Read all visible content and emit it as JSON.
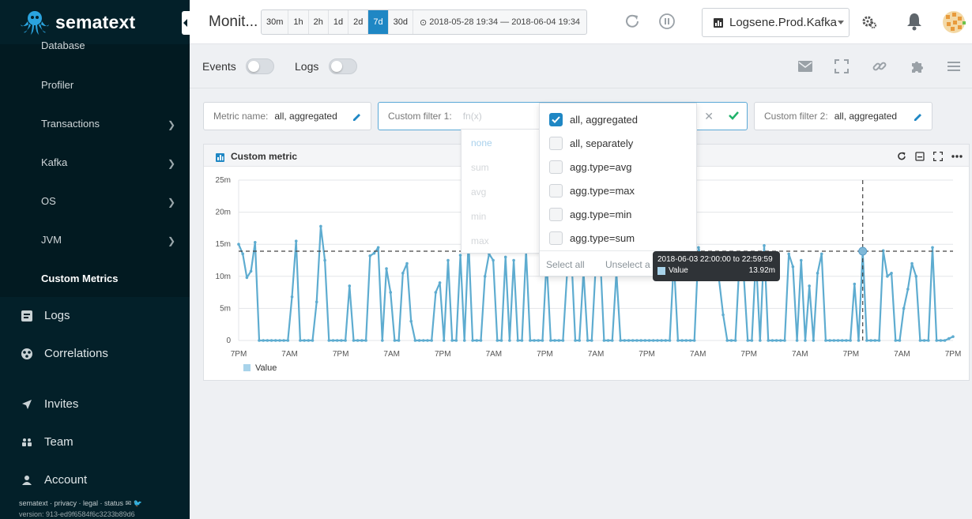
{
  "brand": {
    "name": "sematext"
  },
  "sidebar": {
    "subitems": [
      {
        "label": "Database",
        "chevron": false
      },
      {
        "label": "Profiler",
        "chevron": false
      },
      {
        "label": "Transactions",
        "chevron": true
      },
      {
        "label": "Kafka",
        "chevron": true
      },
      {
        "label": "OS",
        "chevron": true
      },
      {
        "label": "JVM",
        "chevron": true
      },
      {
        "label": "Custom Metrics",
        "chevron": false,
        "active": true
      }
    ],
    "nav": [
      {
        "label": "Logs",
        "icon": "logs-icon"
      },
      {
        "label": "Correlations",
        "icon": "correlations-icon"
      },
      {
        "label": "Invites",
        "icon": "paper-plane-icon"
      },
      {
        "label": "Team",
        "icon": "team-icon"
      },
      {
        "label": "Account",
        "icon": "user-icon"
      }
    ],
    "footer_links": "sematext · privacy · legal · status",
    "version": "version: 913-ed9f6584f6c3233b89d6"
  },
  "header": {
    "title": "Monit...",
    "ranges": [
      "30m",
      "1h",
      "2h",
      "1d",
      "2d",
      "7d",
      "30d"
    ],
    "active_range": "7d",
    "date_range": "2018-05-28 19:34 — 2018-06-04 19:34",
    "app_selector": "Logsene.Prod.Kafka"
  },
  "toolbar": {
    "events_label": "Events",
    "logs_label": "Logs"
  },
  "filters": {
    "metric_name": {
      "label": "Metric name:",
      "value": "all, aggregated"
    },
    "custom1": {
      "label": "Custom filter 1:",
      "placeholder": "fn(x)"
    },
    "custom2": {
      "label": "Custom filter 2:",
      "value": "all, aggregated"
    }
  },
  "fn_options": [
    "none",
    "sum",
    "avg",
    "min",
    "max"
  ],
  "filter_options": [
    {
      "label": "all, aggregated",
      "checked": true
    },
    {
      "label": "all, separately",
      "checked": false
    },
    {
      "label": "agg.type=avg",
      "checked": false
    },
    {
      "label": "agg.type=max",
      "checked": false
    },
    {
      "label": "agg.type=min",
      "checked": false
    },
    {
      "label": "agg.type=sum",
      "checked": false
    }
  ],
  "select_all": "Select all",
  "unselect_all": "Unselect a",
  "panel": {
    "title": "Custom metric"
  },
  "tooltip": {
    "time": "2018-06-03 22:00:00 to 22:59:59",
    "series": "Value",
    "value": "13.92m"
  },
  "colors": {
    "sidebar": "#032029",
    "accent": "#1f87c4",
    "series": "#5eacd0",
    "check": "#20b26a"
  },
  "chart_data": {
    "type": "line",
    "yticks": [
      "0",
      "5m",
      "10m",
      "15m",
      "20m",
      "25m"
    ],
    "ylim": [
      0,
      25
    ],
    "unit": "m",
    "xticks": [
      "7PM",
      "7AM",
      "7PM",
      "7AM",
      "7PM",
      "7AM",
      "7PM",
      "7AM",
      "7PM",
      "7AM",
      "7PM",
      "7AM",
      "7PM",
      "7AM",
      "7PM"
    ],
    "reference_line": 13.92,
    "series": [
      {
        "name": "Value",
        "values": [
          15,
          13.5,
          9.8,
          10.8,
          15.3,
          0,
          0,
          0,
          0,
          0,
          0,
          0,
          0,
          6.8,
          15.5,
          0,
          0,
          0,
          0,
          6,
          17.8,
          12.5,
          0,
          0,
          0,
          0,
          0,
          8.5,
          0,
          0,
          0,
          0,
          13.2,
          13.6,
          14.5,
          0,
          11.2,
          7.5,
          0,
          0,
          10.5,
          12,
          3,
          0,
          0,
          0,
          0,
          0,
          7.5,
          9,
          0,
          12.5,
          0,
          0,
          13.3,
          0,
          15.5,
          0,
          0,
          0,
          10,
          13.5,
          12.5,
          0,
          0,
          13,
          0,
          12.5,
          0,
          0,
          14,
          0,
          0,
          0,
          0,
          12.5,
          0,
          0,
          0,
          0,
          10.5,
          14,
          0,
          0,
          10.8,
          0,
          0,
          12,
          14,
          0,
          0,
          0,
          10.7,
          0,
          0,
          0,
          0,
          0,
          0,
          0,
          0,
          0,
          0,
          0,
          0,
          0,
          12.5,
          0,
          0,
          0,
          0,
          0,
          14.5,
          12,
          11,
          10,
          9.5,
          9.5,
          4,
          0,
          0,
          0,
          12.5,
          10.5,
          0,
          0,
          13,
          0,
          14.8,
          0,
          0,
          0,
          0,
          0,
          13.5,
          11.5,
          0,
          12.5,
          0,
          8.5,
          0,
          10.5,
          13.5,
          0,
          0,
          0,
          0,
          0,
          0,
          0,
          8.8,
          0,
          13.9,
          0,
          0,
          0,
          0,
          14,
          10,
          10.5,
          0,
          0,
          5,
          8,
          12,
          10,
          0,
          0,
          0,
          14.5,
          0,
          0,
          0,
          0.3,
          0.6
        ]
      }
    ],
    "legend": "bottom-left",
    "grid": true
  }
}
